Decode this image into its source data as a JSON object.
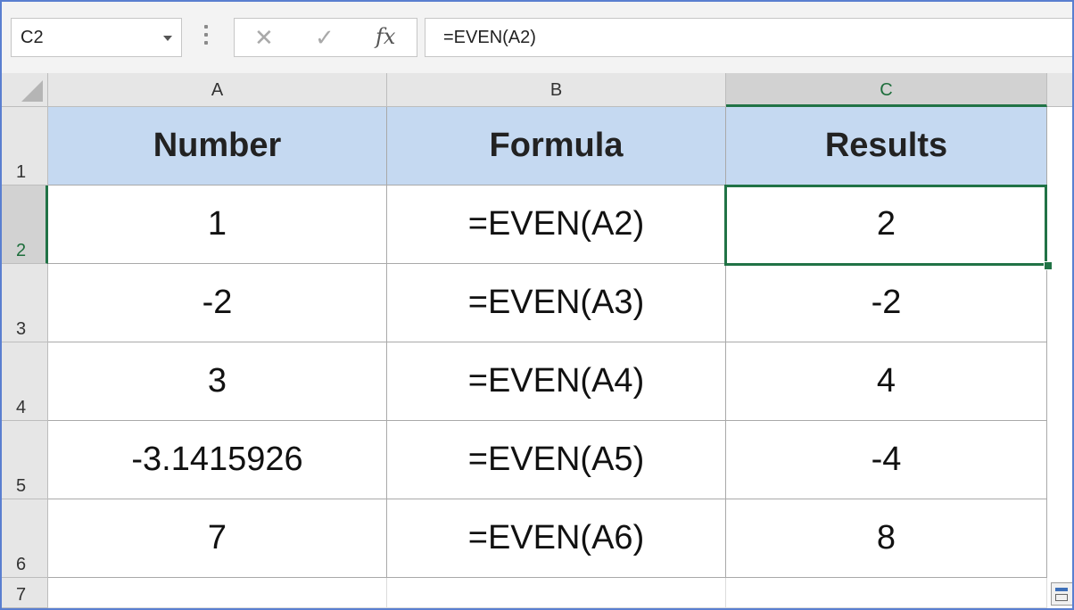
{
  "formula_bar": {
    "name_box": "C2",
    "cancel_icon": "✕",
    "enter_icon": "✓",
    "fx_label": "fx",
    "formula": "=EVEN(A2)"
  },
  "columns": [
    "A",
    "B",
    "C"
  ],
  "rows": [
    "1",
    "2",
    "3",
    "4",
    "5",
    "6",
    "7"
  ],
  "table": {
    "headers": [
      "Number",
      "Formula",
      "Results"
    ],
    "data": [
      [
        "1",
        "=EVEN(A2)",
        "2"
      ],
      [
        "-2",
        "=EVEN(A3)",
        "-2"
      ],
      [
        "3",
        "=EVEN(A4)",
        "4"
      ],
      [
        "-3.1415926",
        "=EVEN(A5)",
        "-4"
      ],
      [
        "7",
        "=EVEN(A6)",
        "8"
      ]
    ]
  },
  "selection": {
    "active_cell": "C2"
  },
  "colors": {
    "header_fill": "#c5d9f1",
    "selection": "#217346",
    "window_border": "#5a7fd0"
  }
}
